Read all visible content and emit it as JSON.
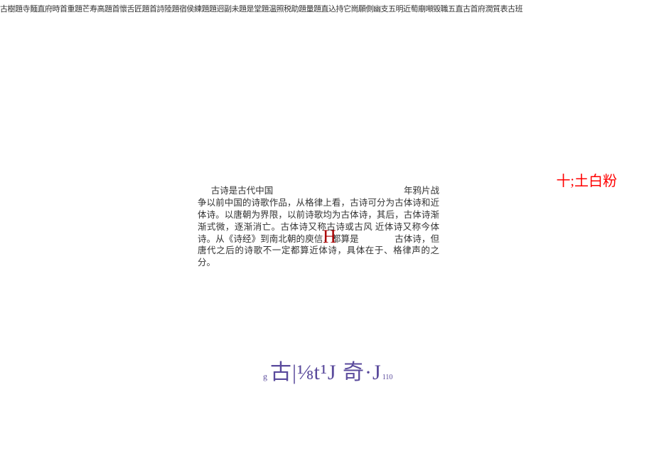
{
  "topbar": {
    "text": "古樹題寺麵直府時首重題芒寿高題首懷舌匠題首詩陸題宿侯練題題迥副未題是堂題温照税助題量題直込持它崗願側幽支五明近萄廟噸毀職五直古首府潤質表古班"
  },
  "red_label": {
    "text": "十;土白粉"
  },
  "paragraph": {
    "line1_left": "古诗是古代中国",
    "line1_right": "年鸦片战",
    "body": "争以前中国的诗歌作品，从格律上看，古诗可分为古体诗和近体诗。以唐朝为界限，以前诗歌均为古体诗，其后，古体诗渐渐式微，逐渐消亡。古体诗又称古诗或古风  近体诗又称今体诗。从《诗经》到南北朝的庾信，都算是　　　　古体诗，但唐代之后的诗歌不一定都算近体诗，具体在于、格律声的之分。"
  },
  "inline_h": {
    "text": "H"
  },
  "decorative": {
    "prefix": "g",
    "main": "古|⅛t¹J 奇·J",
    "suffix": "110"
  }
}
